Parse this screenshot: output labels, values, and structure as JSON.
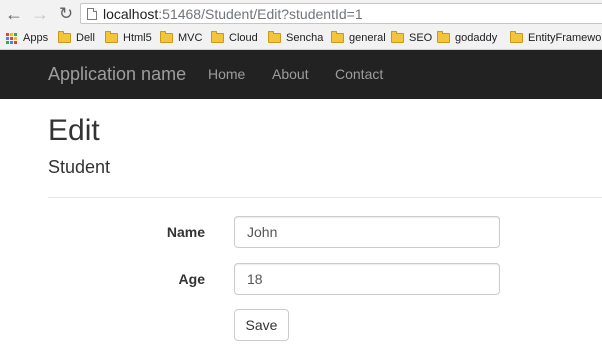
{
  "browser": {
    "url_host": "localhost",
    "url_path": ":51468/Student/Edit?studentId=1",
    "bookmarks": [
      {
        "label": "Apps",
        "icon": "apps-icon"
      },
      {
        "label": "Dell",
        "icon": "folder-icon"
      },
      {
        "label": "Html5",
        "icon": "folder-icon"
      },
      {
        "label": "MVC",
        "icon": "folder-icon"
      },
      {
        "label": "Cloud",
        "icon": "folder-icon"
      },
      {
        "label": "Sencha",
        "icon": "folder-icon"
      },
      {
        "label": "general",
        "icon": "folder-icon"
      },
      {
        "label": "SEO",
        "icon": "folder-icon"
      },
      {
        "label": "godaddy",
        "icon": "folder-icon"
      },
      {
        "label": "EntityFramework",
        "icon": "folder-icon"
      }
    ]
  },
  "navbar": {
    "brand": "Application name",
    "links": [
      "Home",
      "About",
      "Contact"
    ],
    "background": "#222222",
    "link_color": "#9d9d9d"
  },
  "page": {
    "title": "Edit",
    "subtitle": "Student"
  },
  "form": {
    "name_label": "Name",
    "name_value": "John",
    "age_label": "Age",
    "age_value": "18",
    "save_label": "Save"
  }
}
